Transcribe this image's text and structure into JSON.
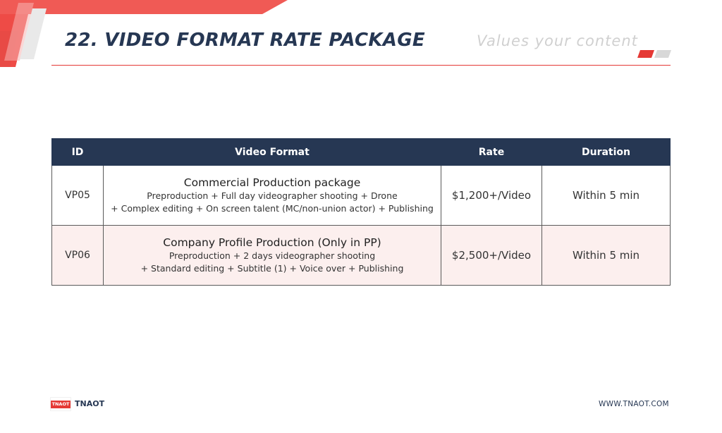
{
  "header": {
    "title": "22. VIDEO FORMAT RATE PACKAGE",
    "tagline": "Values your content",
    "accent_color": "#e53935",
    "navy_color": "#263753"
  },
  "table": {
    "headers": {
      "id": "ID",
      "format": "Video Format",
      "rate": "Rate",
      "duration": "Duration"
    },
    "rows": [
      {
        "id": "VP05",
        "title": "Commercial Production package",
        "line1": "Preproduction + Full day videographer shooting + Drone",
        "line2": "+ Complex editing + On screen talent (MC/non-union actor) + Publishing",
        "rate": "$1,200+/Video",
        "duration": "Within 5 min"
      },
      {
        "id": "VP06",
        "title": "Company Profile Production (Only in PP)",
        "line1": "Preproduction + 2 days videographer shooting",
        "line2": "+ Standard editing + Subtitle (1) + Voice over + Publishing",
        "rate": "$2,500+/Video",
        "duration": "Within 5 min"
      }
    ]
  },
  "footer": {
    "logo_text": "TNAOT",
    "brand": "TNAOT",
    "website": "WWW.TNAOT.COM"
  }
}
